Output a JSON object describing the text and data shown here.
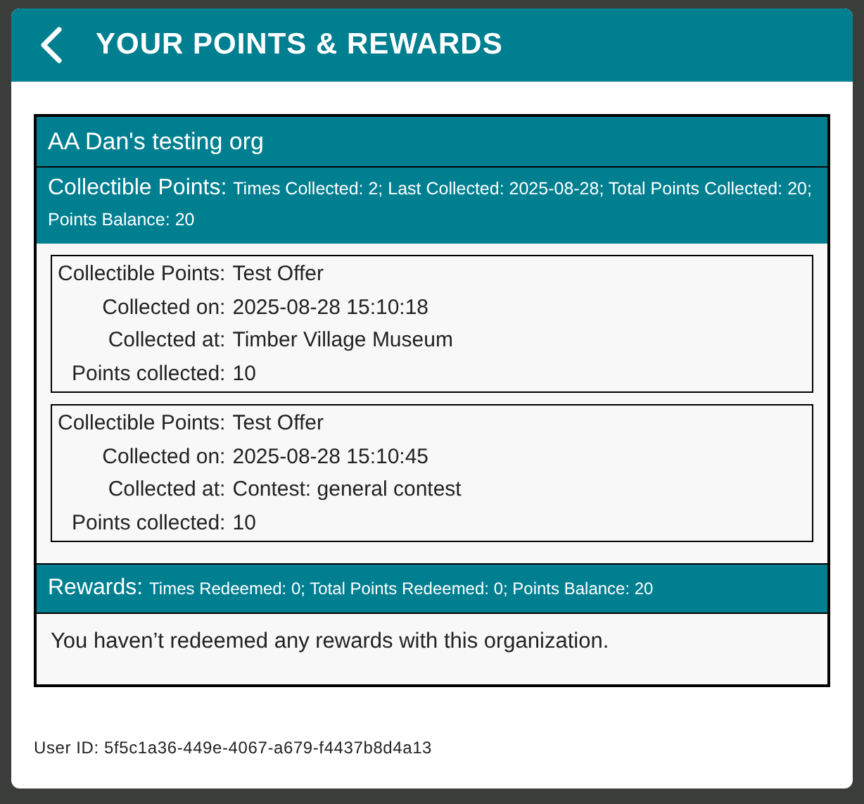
{
  "header": {
    "title": "YOUR POINTS & REWARDS"
  },
  "organization": {
    "name": "AA Dan's testing org",
    "collectible_summary": {
      "label": "Collectible Points:",
      "details": "Times Collected: 2; Last Collected: 2025-08-28; Total Points Collected: 20; Points Balance: 20"
    },
    "collections": [
      {
        "fields": [
          {
            "label": "Collectible Points:",
            "value": "Test Offer"
          },
          {
            "label": "Collected on:",
            "value": "2025-08-28 15:10:18"
          },
          {
            "label": "Collected at:",
            "value": "Timber Village Museum"
          },
          {
            "label": "Points collected:",
            "value": "10"
          }
        ]
      },
      {
        "fields": [
          {
            "label": "Collectible Points:",
            "value": "Test Offer"
          },
          {
            "label": "Collected on:",
            "value": "2025-08-28 15:10:45"
          },
          {
            "label": "Collected at:",
            "value": "Contest: general contest"
          },
          {
            "label": "Points collected:",
            "value": "10"
          }
        ]
      }
    ],
    "rewards_summary": {
      "label": "Rewards:",
      "details": "Times Redeemed: 0; Total Points Redeemed: 0; Points Balance: 20"
    },
    "rewards_message": "You haven’t redeemed any rewards with this organization."
  },
  "user_id": "User ID: 5f5c1a36-449e-4067-a679-f4437b8d4a13"
}
